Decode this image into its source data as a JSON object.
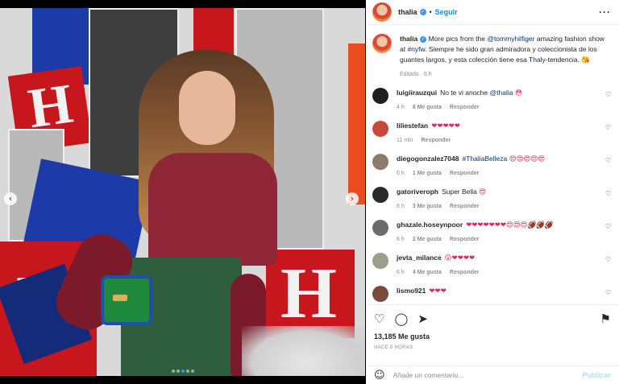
{
  "post": {
    "username": "thalia",
    "follow_label": "Seguir",
    "separator": "•",
    "more_icon": "more-icon",
    "caption": {
      "username": "thalia",
      "text_before": " More pics from the ",
      "mention": "@tommyhilfiger",
      "text_middle": " amazing fashion show at ",
      "hashtag": "#nyfw",
      "text_after": ". Siempre he sido gran admiradora y coleccionista de los guantes largos, y esta colección tiene esa Thaly-tendencia. 😘",
      "meta": "Editado · 6 h"
    },
    "likes": "13,185 Me gusta",
    "time": "HACE 6 HORAS",
    "add_comment_placeholder": "Añade un comentario...",
    "post_button": "Publicar"
  },
  "comments": [
    {
      "user": "luigiirauzqui",
      "text": "No te vi anoche ",
      "mention": "@thalia",
      "tail": " 😳",
      "time": "4 h",
      "likes": "8 Me gusta",
      "reply": "Responder",
      "avatar_color": "#1f1f1f"
    },
    {
      "user": "liliestefan",
      "text": "",
      "mention": "",
      "tail": "❤❤❤❤❤",
      "time": "11 min",
      "likes": "",
      "reply": "Responder",
      "avatar_color": "#c94a3a"
    },
    {
      "user": "diegogonzalez7048",
      "text": "",
      "mention": "#ThaliaBelleza",
      "tail": " 😍😍😍😍😍",
      "time": "6 h",
      "likes": "1 Me gusta",
      "reply": "Responder",
      "avatar_color": "#8c7a6a"
    },
    {
      "user": "gatoriveroph",
      "text": "Super Bella ",
      "mention": "",
      "tail": "😍",
      "time": "6 h",
      "likes": "3 Me gusta",
      "reply": "Responder",
      "avatar_color": "#2a2a2a"
    },
    {
      "user": "ghazale.hoseynpoor",
      "text": "",
      "mention": "",
      "tail": "❤❤❤❤❤❤❤😍😍😍🏈🏈🏈",
      "time": "6 h",
      "likes": "2 Me gusta",
      "reply": "Responder",
      "avatar_color": "#6c6c6c"
    },
    {
      "user": "jevta_milance",
      "text": "",
      "mention": "",
      "tail": "😮❤❤❤❤",
      "time": "6 h",
      "likes": "4 Me gusta",
      "reply": "Responder",
      "avatar_color": "#9aa08a"
    },
    {
      "user": "lismo921",
      "text": "",
      "mention": "",
      "tail": "❤❤❤",
      "time": "",
      "likes": "",
      "reply": "",
      "avatar_color": "#7a4a3a"
    }
  ],
  "carousel": {
    "prev_icon": "‹",
    "next_icon": "›",
    "slides": 5,
    "active_slide": 2
  },
  "colors": {
    "accent": "#0095f6",
    "verified": "#3897f0",
    "heart": "#e0245e",
    "muted": "#8e8e8e"
  },
  "icons": {
    "like": "♡",
    "comment": "◯",
    "share": "➤",
    "save": "⚑",
    "emoji": "☺",
    "comment_like": "♡"
  }
}
